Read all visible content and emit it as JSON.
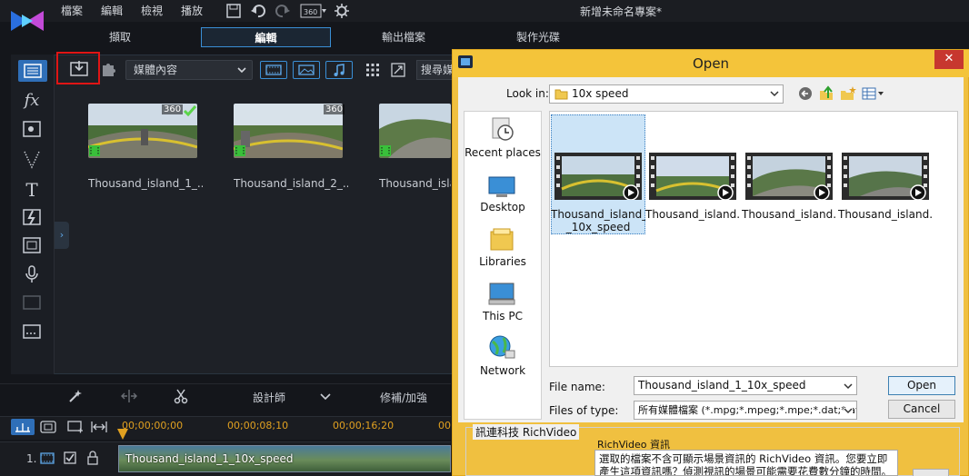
{
  "app": {
    "menu": [
      "檔案",
      "編輯",
      "檢視",
      "播放"
    ],
    "project_title": "新增未命名專案*"
  },
  "tabs": [
    {
      "label": "擷取",
      "active": false
    },
    {
      "label": "編輯",
      "active": true
    },
    {
      "label": "輸出檔案",
      "active": false
    },
    {
      "label": "製作光碟",
      "active": false
    }
  ],
  "library": {
    "media_filter": "媒體內容",
    "search_placeholder": "搜尋媒",
    "items": [
      {
        "label": "Thousand_island_1_...",
        "badge": "360"
      },
      {
        "label": "Thousand_island_2_...",
        "badge": "360"
      },
      {
        "label": "Thousand_isla",
        "badge": ""
      }
    ]
  },
  "midtoolbar": {
    "designer_label": "設計師",
    "fix_label": "修補/加強"
  },
  "timeline": {
    "times": [
      "00;00;00;00",
      "00;00;08;10",
      "00;00;16;20",
      "00;00;2"
    ],
    "track_number": "1.",
    "clip_label": "Thousand_island_1_10x_speed"
  },
  "dialog": {
    "title": "Open",
    "close": "✕",
    "look_in_label": "Look in:",
    "look_in_value": "10x speed",
    "places": [
      "Recent places",
      "Desktop",
      "Libraries",
      "This PC",
      "Network"
    ],
    "files": [
      {
        "label_line1": "Thousand_island_1",
        "label_line2": "_10x_speed",
        "selected": true
      },
      {
        "label_line1": "Thousand_island...",
        "label_line2": "",
        "selected": false
      },
      {
        "label_line1": "Thousand_island...",
        "label_line2": "",
        "selected": false
      },
      {
        "label_line1": "Thousand_island...",
        "label_line2": "",
        "selected": false
      }
    ],
    "file_name_label": "File name:",
    "file_name_value": "Thousand_island_1_10x_speed",
    "file_type_label": "Files of type:",
    "file_type_value": "所有媒體檔案 (*.mpg;*.mpeg;*.mpe;*.dat;*.avi;",
    "open_button": "Open",
    "cancel_button": "Cancel",
    "richvideo_group": "訊連科技 RichVideo",
    "richvideo_sub": "RichVideo 資訊",
    "richvideo_text": "選取的檔案不含可顯示場景資訊的 RichVideo 資訊。您要立即產生這項資訊嗎？偵測視訊的場景可能需要花費數分鐘的時間。"
  },
  "colors": {
    "accent": "#3a8fd6",
    "dialog_frame": "#f4c43a",
    "close_red": "#c7372f",
    "import_highlight": "#e01515"
  }
}
